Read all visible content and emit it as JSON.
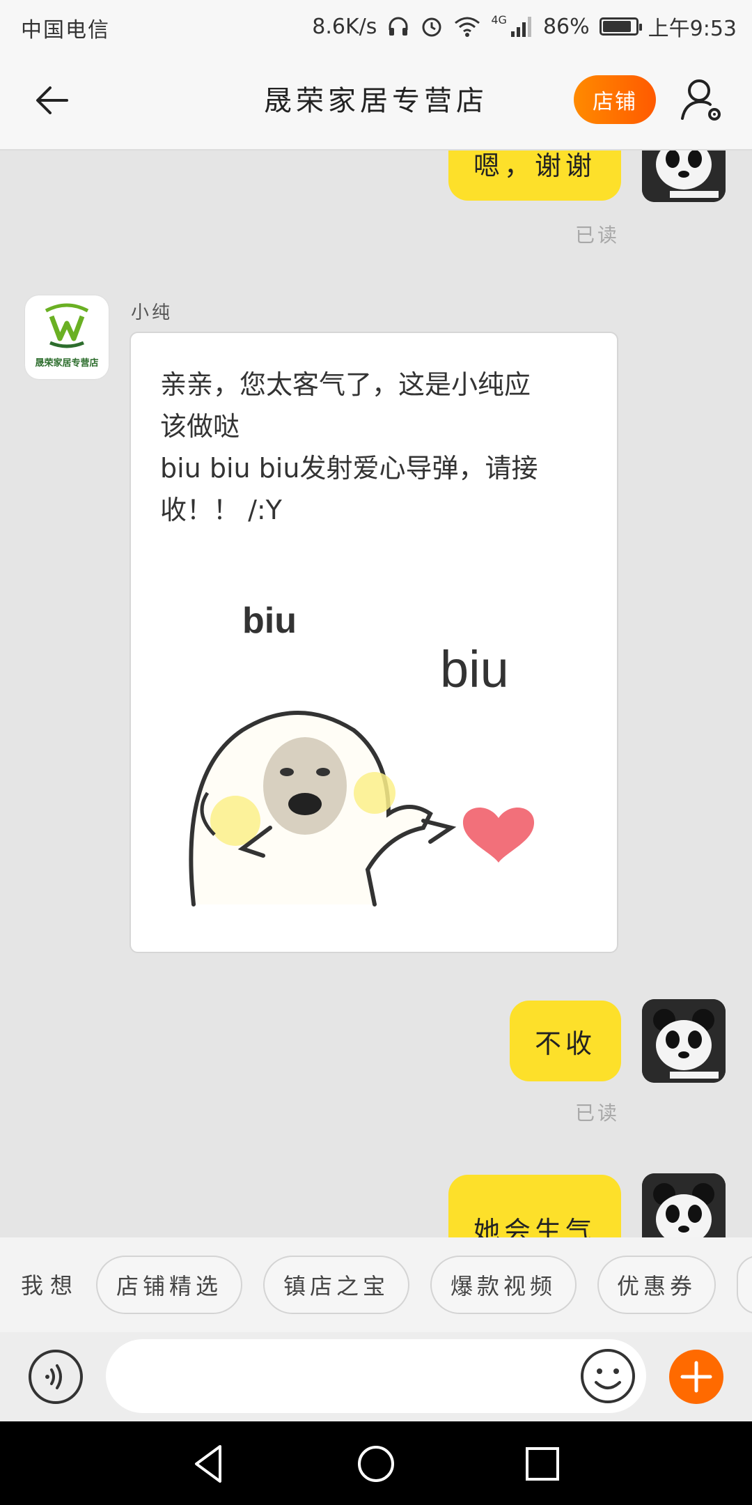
{
  "status_bar": {
    "carrier": "中国电信",
    "speed": "8.6K/s",
    "network": "4G",
    "battery": "86%",
    "battery_level": 0.86,
    "time": "上午9:53"
  },
  "header": {
    "title": "晟荣家居专营店",
    "store_button": "店铺"
  },
  "messages": [
    {
      "from": "me",
      "text": "嗯，谢谢",
      "status": "已读"
    },
    {
      "from": "shop",
      "sender": "小纯",
      "avatar_text": "晟荣家居专营店",
      "lines": [
        "亲亲，您太客气了，这是小纯应",
        "该做哒",
        "biu biu biu发射爱心导弹，请接",
        "收！！ /:Y"
      ],
      "sticker": {
        "text1": "biu",
        "text2": "biu"
      }
    },
    {
      "from": "me",
      "text": "不收",
      "status": "已读"
    },
    {
      "from": "me",
      "text": "她会生气"
    }
  ],
  "my_avatar_caption": "熊猫",
  "suggestions": {
    "label": "我想",
    "chips": [
      "店铺精选",
      "镇店之宝",
      "爆款视频",
      "优惠券"
    ]
  },
  "input": {
    "placeholder": ""
  },
  "colors": {
    "accent": "#ff6a00",
    "bubble": "#fde02a",
    "background": "#e5e5e5"
  }
}
